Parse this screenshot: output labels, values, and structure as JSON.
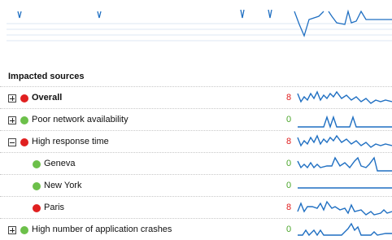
{
  "colors": {
    "line": "#1f6fc2",
    "red": "#e02020",
    "green": "#6cc04a",
    "count_red": "#e02020",
    "count_green": "#4aa52a"
  },
  "section": {
    "title": "Impacted sources"
  },
  "rows": [
    {
      "label": "Overall",
      "bold": true,
      "status": "red",
      "count": "8",
      "expandable": true,
      "expanded": false,
      "indent": 0,
      "icon": "plus-icon"
    },
    {
      "label": "Poor network availability",
      "bold": false,
      "status": "green",
      "count": "0",
      "expandable": true,
      "expanded": false,
      "indent": 0,
      "icon": "plus-icon"
    },
    {
      "label": "High response time",
      "bold": false,
      "status": "red",
      "count": "8",
      "expandable": true,
      "expanded": true,
      "indent": 0,
      "icon": "minus-icon"
    },
    {
      "label": "Geneva",
      "bold": false,
      "status": "green",
      "count": "0",
      "expandable": false,
      "expanded": false,
      "indent": 1
    },
    {
      "label": "New York",
      "bold": false,
      "status": "green",
      "count": "0",
      "expandable": false,
      "expanded": false,
      "indent": 1
    },
    {
      "label": "Paris",
      "bold": false,
      "status": "red",
      "count": "8",
      "expandable": false,
      "expanded": false,
      "indent": 1
    },
    {
      "label": "High number of application crashes",
      "bold": false,
      "status": "green",
      "count": "0",
      "expandable": true,
      "expanded": false,
      "indent": 0,
      "icon": "plus-icon"
    }
  ]
}
